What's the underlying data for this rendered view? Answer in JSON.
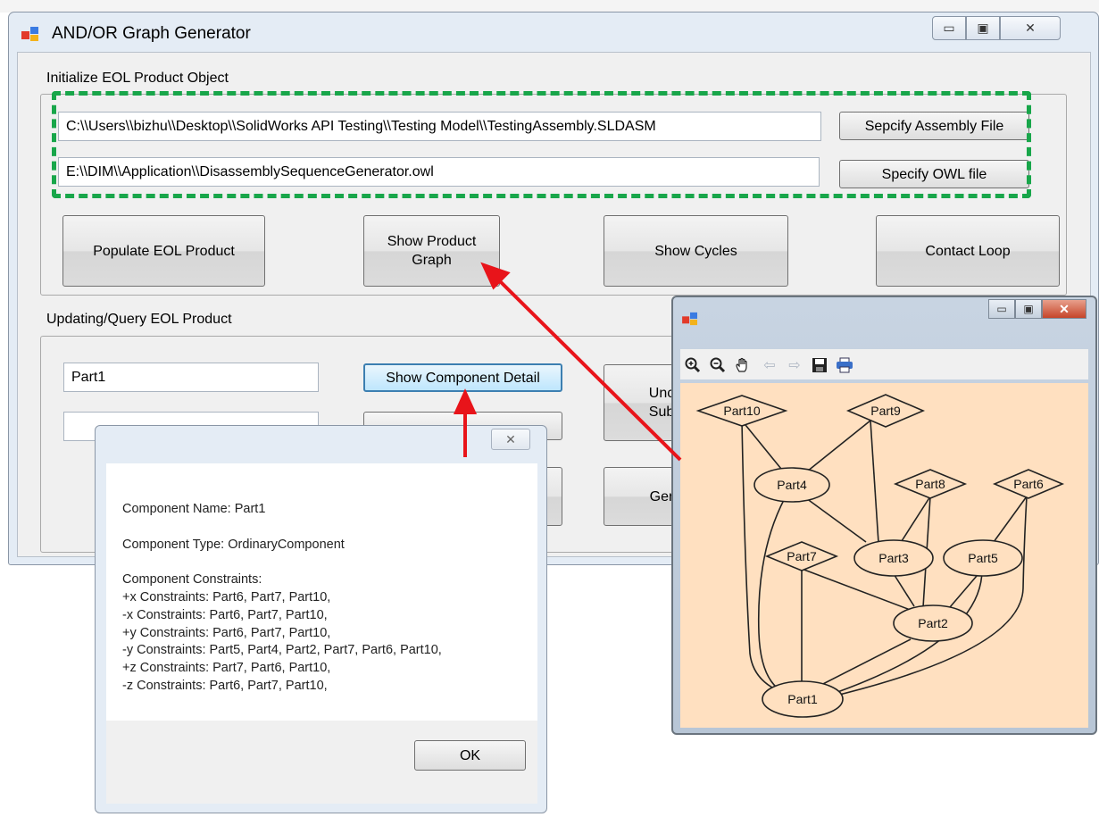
{
  "main_window": {
    "title": "AND/OR Graph Generator",
    "caption_buttons": [
      "minimize",
      "maximize",
      "close"
    ],
    "group1": {
      "label": "Initialize EOL Product Object",
      "assembly_path": "C:\\\\Users\\\\bizhu\\\\Desktop\\\\SolidWorks API Testing\\\\Testing Model\\\\TestingAssembly.SLDASM",
      "owl_path": "E:\\\\DIM\\\\Application\\\\DisassemblySequenceGenerator.owl",
      "specify_assembly_label": "Sepcify Assembly File",
      "specify_owl_label": "Specify OWL file",
      "populate_label": "Populate EOL Product",
      "show_graph_label": "Show Product Graph",
      "show_cycles_label": "Show Cycles",
      "contact_loop_label": "Contact Loop"
    },
    "group2": {
      "label": "Updating/Query EOL Product",
      "component_input": "Part1",
      "show_detail_label": "Show Component Detail",
      "partial_button_a": "Unc\nSub",
      "partial_button_b": "Ger"
    }
  },
  "detail_dialog": {
    "lines": [
      "Component Name: Part1",
      "",
      "Component Type: OrdinaryComponent",
      "",
      "Component Constraints:",
      "+x Constraints: Part6, Part7, Part10,",
      "-x Constraints: Part6, Part7, Part10,",
      "+y Constraints: Part6, Part7, Part10,",
      "-y Constraints: Part5, Part4, Part2, Part7, Part6, Part10,",
      "+z Constraints: Part7, Part6, Part10,",
      "-z Constraints: Part6, Part7, Part10,"
    ],
    "ok_label": "OK"
  },
  "graph_window": {
    "toolbar_icons": [
      "zoom-in-icon",
      "zoom-out-icon",
      "pan-hand-icon",
      "back-arrow-icon",
      "forward-arrow-icon",
      "save-icon",
      "print-icon"
    ],
    "nodes": [
      {
        "id": "Part10",
        "label": "Part10",
        "shape": "diamond"
      },
      {
        "id": "Part9",
        "label": "Part9",
        "shape": "diamond"
      },
      {
        "id": "Part4",
        "label": "Part4",
        "shape": "ellipse"
      },
      {
        "id": "Part8",
        "label": "Part8",
        "shape": "diamond"
      },
      {
        "id": "Part6",
        "label": "Part6",
        "shape": "diamond"
      },
      {
        "id": "Part7",
        "label": "Part7",
        "shape": "diamond"
      },
      {
        "id": "Part3",
        "label": "Part3",
        "shape": "ellipse"
      },
      {
        "id": "Part5",
        "label": "Part5",
        "shape": "ellipse"
      },
      {
        "id": "Part2",
        "label": "Part2",
        "shape": "ellipse"
      },
      {
        "id": "Part1",
        "label": "Part1",
        "shape": "ellipse"
      }
    ],
    "edges": [
      [
        "Part10",
        "Part4"
      ],
      [
        "Part10",
        "Part1"
      ],
      [
        "Part9",
        "Part4"
      ],
      [
        "Part9",
        "Part3"
      ],
      [
        "Part4",
        "Part3"
      ],
      [
        "Part4",
        "Part1"
      ],
      [
        "Part8",
        "Part3"
      ],
      [
        "Part8",
        "Part2"
      ],
      [
        "Part6",
        "Part5"
      ],
      [
        "Part6",
        "Part1"
      ],
      [
        "Part7",
        "Part2"
      ],
      [
        "Part7",
        "Part1"
      ],
      [
        "Part3",
        "Part2"
      ],
      [
        "Part5",
        "Part2"
      ],
      [
        "Part5",
        "Part1"
      ],
      [
        "Part2",
        "Part1"
      ]
    ]
  },
  "colors": {
    "dashed_highlight": "#18a64a",
    "annotation_arrow": "#e8141a",
    "graph_background": "#ffe0c0"
  }
}
